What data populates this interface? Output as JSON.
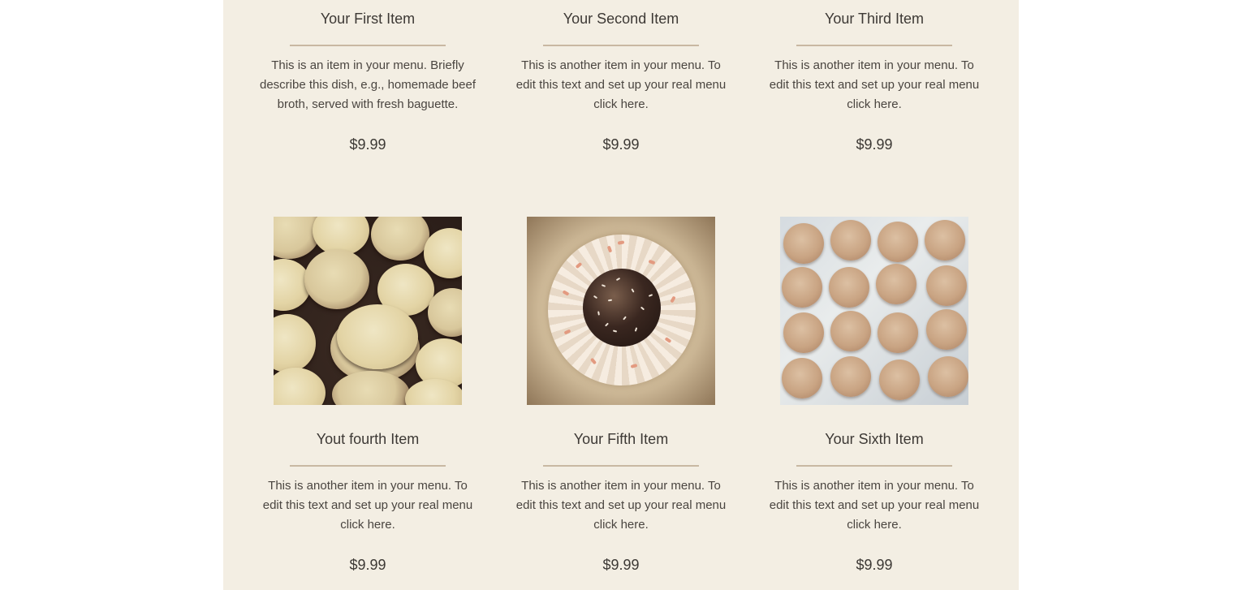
{
  "menu": {
    "items": [
      {
        "title": "Your First Item",
        "description": "This is an item in your menu. Briefly describe this dish, e.g., homemade beef broth, served with fresh baguette.",
        "price": "$9.99"
      },
      {
        "title": "Your Second Item",
        "description": "This is another item in your menu. To edit this text and set up your real menu click here.",
        "price": "$9.99"
      },
      {
        "title": "Your Third Item",
        "description": "This is another item in your menu. To edit this text and set up your real menu click here.",
        "price": "$9.99"
      },
      {
        "title": "Yout fourth Item",
        "description": "This is another item in your menu. To edit this text and set up your real menu click here.",
        "price": "$9.99",
        "photo": "sandwich-cookies-photo"
      },
      {
        "title": "Your Fifth Item",
        "description": "This is another item in your menu. To edit this text and set up your real menu click here.",
        "price": "$9.99",
        "photo": "coconut-chocolate-ball-photo"
      },
      {
        "title": "Your Sixth Item",
        "description": "This is another item in your menu. To edit this text and set up your real menu click here.",
        "price": "$9.99",
        "photo": "crinkle-cookies-photo"
      }
    ]
  },
  "colors": {
    "panel_background": "#f3eee3",
    "divider": "#c8b8a2",
    "text": "#3d3935"
  }
}
